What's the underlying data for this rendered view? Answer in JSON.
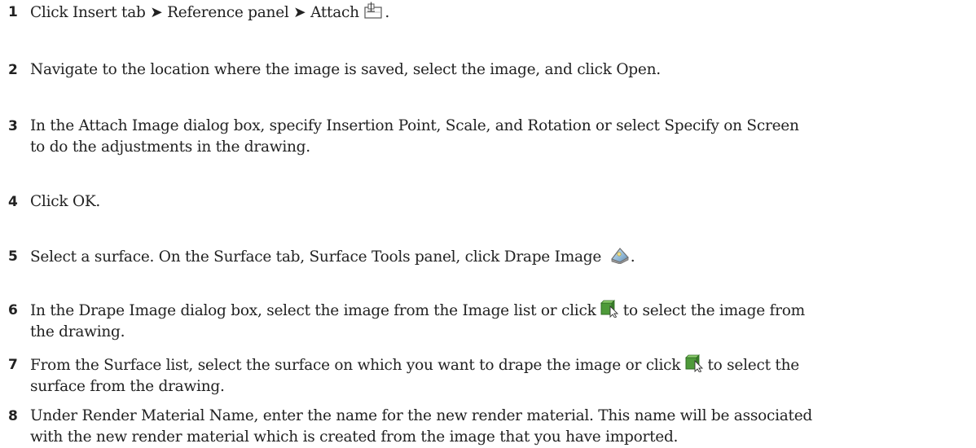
{
  "steps": [
    {
      "number": "1",
      "parts": [
        "Click Insert tab ➤ Reference panel ➤ Attach ",
        "."
      ],
      "icons": [
        "attach-icon"
      ]
    },
    {
      "number": "2",
      "text": "Navigate to the location where the image is saved, select the image, and click Open."
    },
    {
      "number": "3",
      "line1": "In the Attach Image dialog box, specify Insertion Point, Scale, and Rotation or select Specify on Screen",
      "line2": "to do the adjustments in the drawing."
    },
    {
      "number": "4",
      "text": "Click OK."
    },
    {
      "number": "5",
      "parts": [
        "Select a surface. On the Surface tab, Surface Tools panel, click Drape Image ",
        "."
      ],
      "icons": [
        "drape-image-icon"
      ]
    },
    {
      "number": "6",
      "parts": [
        "In the Drape Image dialog box, select the image from the Image list or click ",
        " to select the image from"
      ],
      "line2": "the drawing.",
      "icons": [
        "select-from-drawing-icon"
      ]
    },
    {
      "number": "7",
      "parts": [
        "From the Surface list, select the surface on which you want to drape the image or click ",
        " to select the"
      ],
      "line2": "surface from the drawing.",
      "icons": [
        "select-from-drawing-icon"
      ]
    },
    {
      "number": "8",
      "line1": "Under Render Material Name, enter the name for the new render material. This name will be associated",
      "line2": "with the new render material which is created from the image that you have imported."
    }
  ]
}
